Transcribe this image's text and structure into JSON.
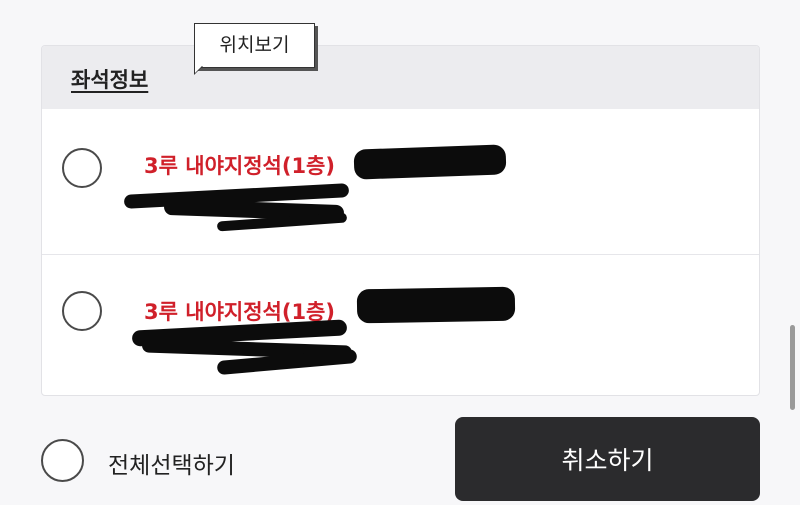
{
  "tooltip": {
    "label": "위치보기"
  },
  "section": {
    "title": "좌석정보"
  },
  "seats": [
    {
      "label": "3루 내야지정석(1층)"
    },
    {
      "label": "3루 내야지정석(1층)"
    }
  ],
  "select_all": {
    "label": "전체선택하기"
  },
  "actions": {
    "cancel_label": "취소하기"
  }
}
